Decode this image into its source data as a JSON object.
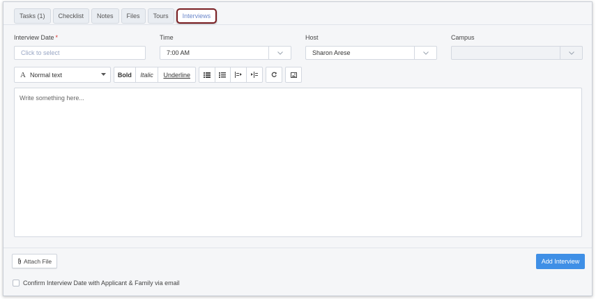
{
  "tabs": [
    {
      "label": "Tasks (1)"
    },
    {
      "label": "Checklist"
    },
    {
      "label": "Notes"
    },
    {
      "label": "Files"
    },
    {
      "label": "Tours"
    },
    {
      "label": "Interviews",
      "active": true
    }
  ],
  "form": {
    "interview_date": {
      "label": "Interview Date",
      "required_mark": "*",
      "placeholder": "Click to select"
    },
    "time": {
      "label": "Time",
      "value": "7:00 AM"
    },
    "host": {
      "label": "Host",
      "value": "Sharon Arese"
    },
    "campus": {
      "label": "Campus",
      "value": ""
    }
  },
  "toolbar": {
    "text_style": "Normal text",
    "text_style_icon": "A",
    "bold": "Bold",
    "italic": "Italic",
    "underline": "Underline",
    "icons": [
      "unordered-list-icon",
      "ordered-list-icon",
      "outdent-icon",
      "indent-icon",
      "redo-icon",
      "image-icon"
    ]
  },
  "editor": {
    "placeholder": "Write something here..."
  },
  "footer": {
    "attach_label": "Attach File",
    "add_label": "Add Interview",
    "confirm_label": "Confirm Interview Date with Applicant & Family via email"
  },
  "colors": {
    "accent": "#3f8fe6",
    "active_tab_outline": "#7a1e22",
    "active_tab_text": "#6a86c9",
    "required": "#d9302c"
  }
}
